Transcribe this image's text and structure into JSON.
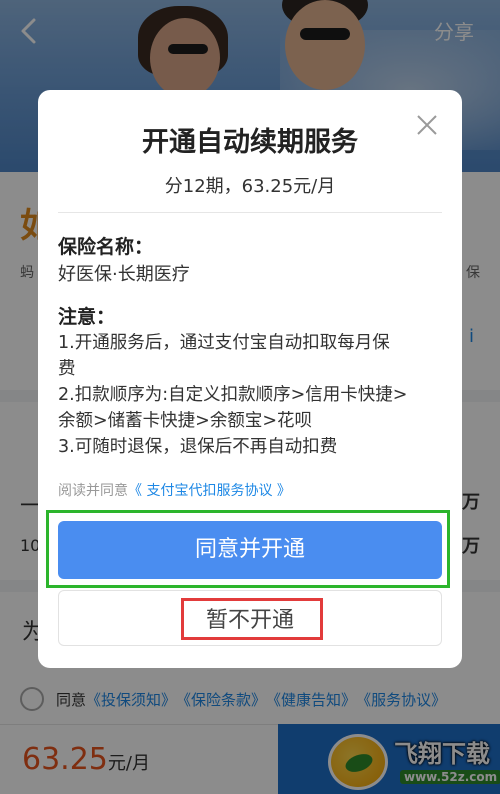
{
  "header": {
    "share_label": "分享"
  },
  "page": {
    "title_fragment": "如",
    "sub_left": "蚂",
    "sub_right": "保",
    "side_link": "i",
    "row_dash": "一",
    "row_10": "10",
    "wan_1": "万",
    "wan_2": "万",
    "section_fragment": "为"
  },
  "agreement_row": {
    "prefix": "同意",
    "links": [
      "《投保须知》",
      "《保险条款》",
      "《健康告知》",
      "《服务协议》"
    ]
  },
  "bottom_bar": {
    "price": "63.25",
    "unit": "元/月"
  },
  "watermark": {
    "text": "飞翔下载",
    "url": "www.52z.com"
  },
  "modal": {
    "title": "开通自动续期服务",
    "subtitle": "分12期，63.25元/月",
    "insurance_label": "保险名称：",
    "insurance_name": "好医保·长期医疗",
    "notice_label": "注意：",
    "notices": [
      "1.开通服务后，通过支付宝自动扣取每月保\n费",
      "2.扣款顺序为:自定义扣款顺序>信用卡快捷>\n余额>储蓄卡快捷>余额宝>花呗",
      "3.可随时退保，退保后不再自动扣费"
    ],
    "read_agree_prefix": "阅读并同意",
    "read_agree_link": "《 支付宝代扣服务协议 》",
    "agree_button": "同意并开通",
    "decline_button": "暂不开通"
  },
  "colors": {
    "primary_button": "#4a8df0",
    "link": "#1e88e5",
    "price": "#e8541e",
    "highlight_green": "#2cb52c",
    "highlight_red": "#e23b3b"
  }
}
